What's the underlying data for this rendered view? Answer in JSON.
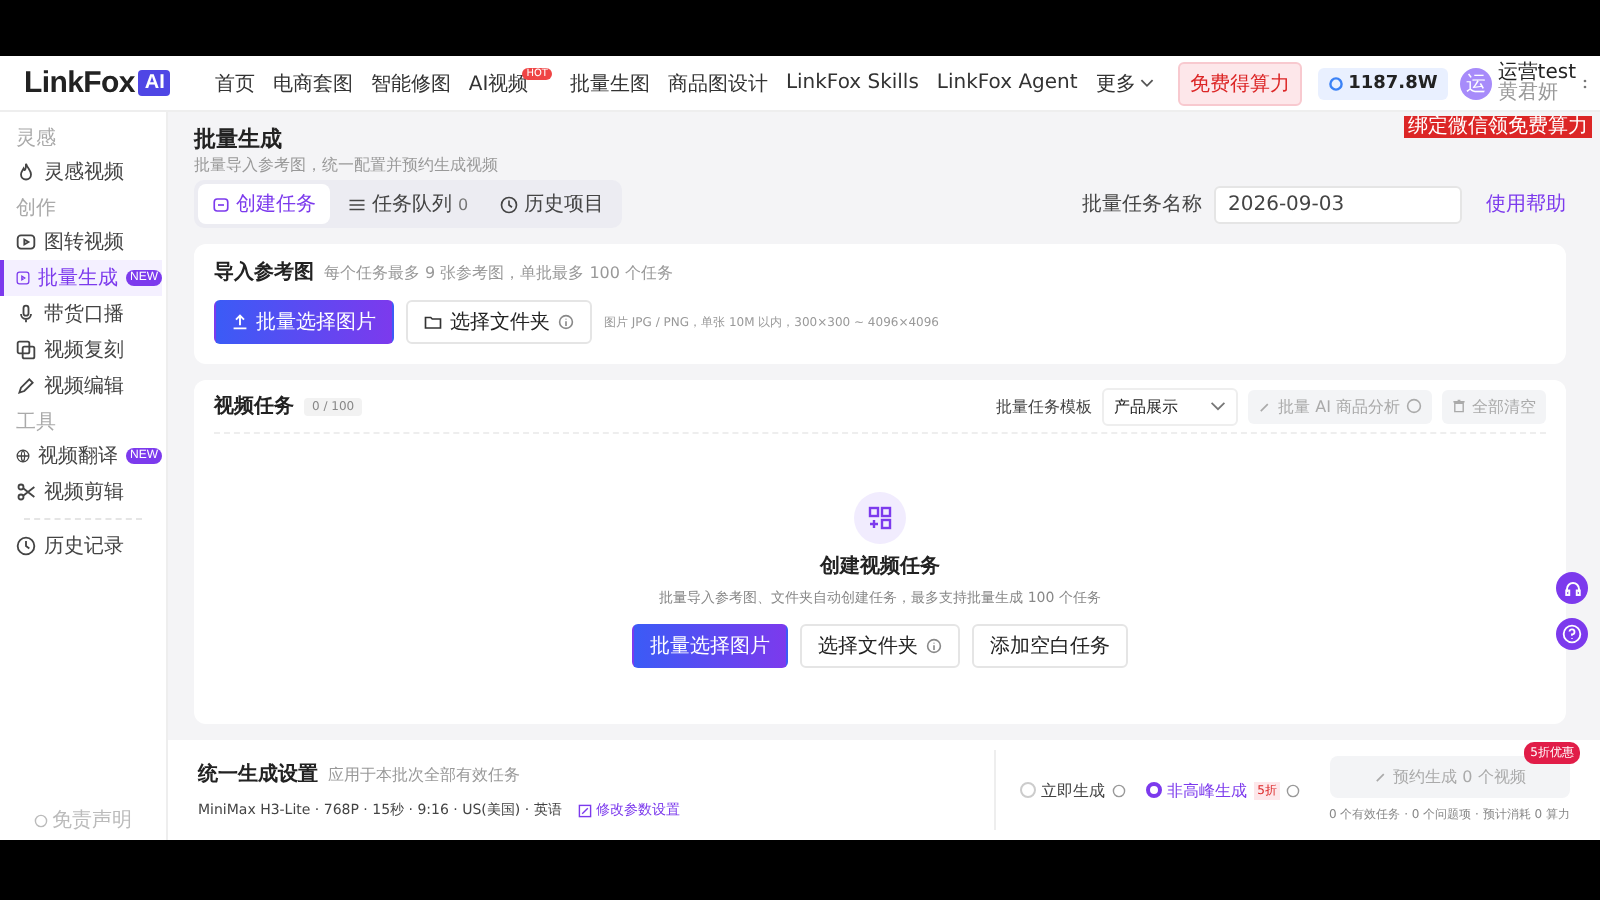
{
  "header": {
    "logo_text": "LinkFox",
    "logo_badge": "AI",
    "nav": [
      {
        "label": "首页",
        "selected": false
      },
      {
        "label": "电商套图",
        "selected": false
      },
      {
        "label": "智能修图",
        "selected": false
      },
      {
        "label": "AI视频",
        "selected": false,
        "badge": "HOT"
      },
      {
        "label": "批量生图",
        "selected": false
      },
      {
        "label": "商品图设计",
        "selected": false
      },
      {
        "label": "LinkFox Skills",
        "selected": false
      },
      {
        "label": "LinkFox Agent",
        "selected": false
      },
      {
        "label": "更多",
        "selected": false
      }
    ],
    "promo_button": "免费得算力",
    "credits": "1187.8W",
    "user": {
      "avatar": "运",
      "name": "运营test",
      "subtitle": "黄君妍",
      "tag": "绑定微信领免费算力"
    }
  },
  "sidebar": {
    "sections": [
      {
        "title": "灵感",
        "items": [
          {
            "label": "灵感视频",
            "selected": false
          }
        ]
      },
      {
        "title": "创作",
        "items": [
          {
            "label": "图转视频",
            "selected": false
          },
          {
            "label": "批量生成",
            "selected": true,
            "badge": "NEW"
          },
          {
            "label": "带货口播",
            "selected": false
          },
          {
            "label": "视频复刻",
            "selected": false
          },
          {
            "label": "视频编辑",
            "selected": false
          }
        ]
      },
      {
        "title": "工具",
        "items": [
          {
            "label": "视频翻译",
            "selected": false,
            "badge": "NEW"
          },
          {
            "label": "视频剪辑",
            "selected": false
          }
        ]
      },
      {
        "items": [
          {
            "label": "历史记录",
            "selected": false
          }
        ]
      }
    ],
    "footer": "免责声明"
  },
  "page": {
    "title": "批量生成",
    "subtitle": "批量导入参考图，统一配置并预约生成视频",
    "tabs": [
      {
        "label": "创建任务",
        "selected": true
      },
      {
        "label": "任务队列",
        "count": "0",
        "selected": false
      },
      {
        "label": "历史项目",
        "selected": false
      }
    ],
    "batch_name_label": "批量任务名称",
    "batch_name_value": "2026-09-03",
    "help_link": "使用帮助"
  },
  "import_card": {
    "title": "导入参考图",
    "hint": "每个任务最多 9 张参考图，单批最多 100 个任务",
    "upload_button": "批量选择图片",
    "folder_button": "选择文件夹",
    "format_hint": "图片 JPG / PNG，单张 10M 以内，300×300 ~ 4096×4096"
  },
  "tasks_card": {
    "title": "视频任务",
    "count": "0 / 100",
    "template_label": "批量任务模板",
    "template_value": "产品展示",
    "analyze_button": {
      "label": "批量 AI 商品分析",
      "disabled": true
    },
    "clear_button": {
      "label": "全部清空",
      "disabled": true
    },
    "empty_title": "创建视频任务",
    "empty_text": "批量导入参考图、文件夹自动创建任务，最多支持批量生成 100 个任务",
    "empty_buttons": [
      {
        "label": "批量选择图片",
        "kind": "primary"
      },
      {
        "label": "选择文件夹",
        "kind": "folder"
      },
      {
        "label": "添加空白任务",
        "kind": "plain"
      }
    ]
  },
  "settings": {
    "title": "统一生成设置",
    "hint": "应用于本批次全部有效任务",
    "params": "MiniMax H3-Lite · 768P · 15秒 · 9:16 · US(美国) · 英语",
    "edit_link": "修改参数设置",
    "modes": [
      {
        "label": "立即生成",
        "selected": false
      },
      {
        "label": "非高峰生成",
        "badge": "5折",
        "selected": true
      }
    ],
    "submit_button": {
      "label": "预约生成 0 个视频",
      "disabled": true,
      "badge": "5折优惠"
    },
    "summary": "0 个有效任务 · 0 个问题项 · 预计消耗 0 算力"
  }
}
